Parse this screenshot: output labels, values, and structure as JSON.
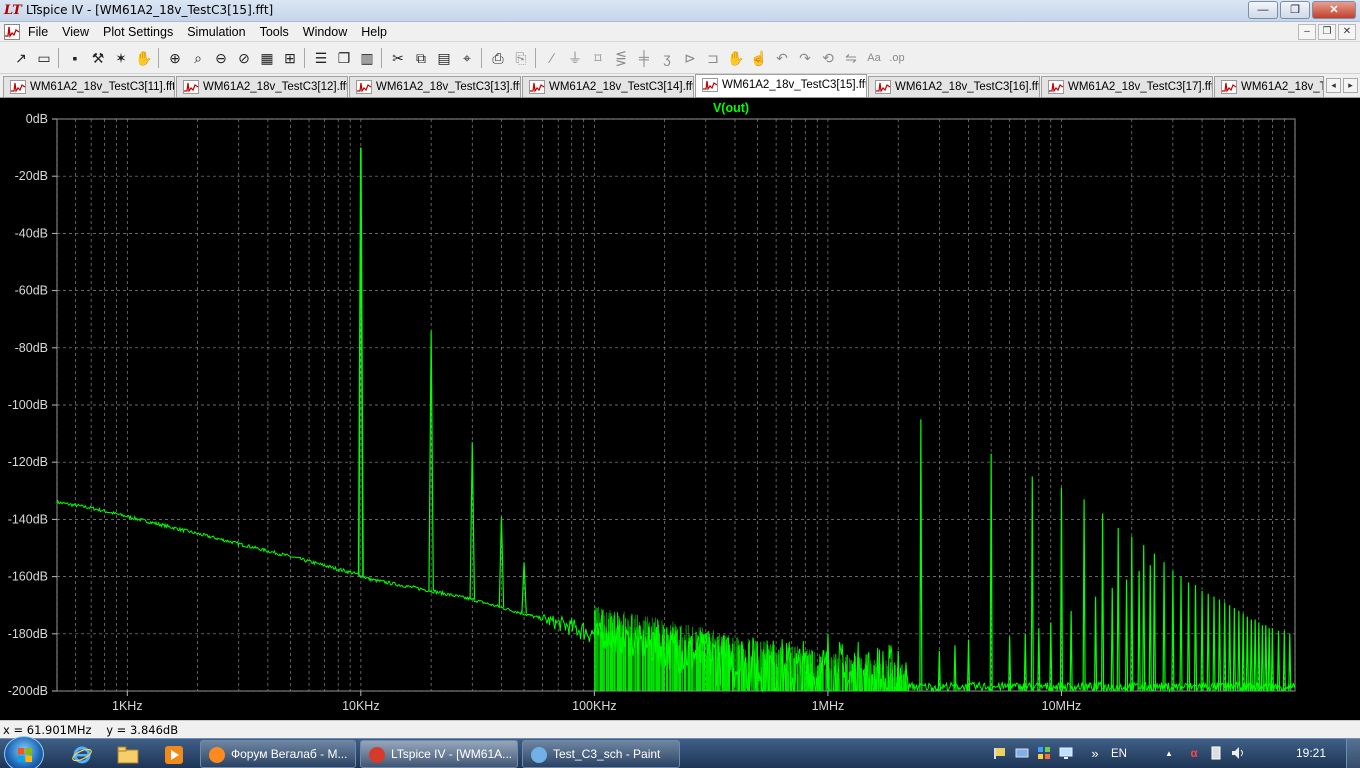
{
  "window": {
    "title": "LTspice IV - [WM61A2_18v_TestC3[15].fft]",
    "logo_text": "LT",
    "minimize_glyph": "—",
    "maximize_glyph": "❐",
    "close_glyph": "✕"
  },
  "menu": {
    "items": [
      "File",
      "View",
      "Plot Settings",
      "Simulation",
      "Tools",
      "Window",
      "Help"
    ],
    "mdi_minimize_glyph": "–",
    "mdi_restore_glyph": "❐",
    "mdi_close_glyph": "✕"
  },
  "toolbar": {
    "icons": [
      "new-schematic-icon",
      "open-icon",
      "save-icon",
      "control-panel-icon",
      "run-icon",
      "pan-icon",
      "zoom-in-icon",
      "zoom-pan-icon",
      "zoom-out-icon",
      "zoom-cancel-icon",
      "autorange-icon",
      "zoom-fit-icon",
      "tile-horizontal-icon",
      "cascade-icon",
      "tile-vertical-icon",
      "cut-icon",
      "copy-icon",
      "paste-icon",
      "find-icon",
      "print-icon",
      "print-preview-icon",
      "wire-icon",
      "ground-icon",
      "label-icon",
      "resistor-icon",
      "capacitor-icon",
      "inductor-icon",
      "diode-icon",
      "component-icon",
      "move-icon",
      "drag-icon",
      "undo-icon",
      "redo-icon",
      "rotate-icon",
      "mirror-icon",
      "text-icon",
      "spice-directive-icon"
    ]
  },
  "tabs": [
    {
      "label": "WM61A2_18v_TestC3[11].fft",
      "active": false
    },
    {
      "label": "WM61A2_18v_TestC3[12].fft",
      "active": false
    },
    {
      "label": "WM61A2_18v_TestC3[13].fft",
      "active": false
    },
    {
      "label": "WM61A2_18v_TestC3[14].fft",
      "active": false
    },
    {
      "label": "WM61A2_18v_TestC3[15].fft",
      "active": true
    },
    {
      "label": "WM61A2_18v_TestC3[16].fft",
      "active": false
    },
    {
      "label": "WM61A2_18v_TestC3[17].fft",
      "active": false
    },
    {
      "label": "WM61A2_18v_T",
      "active": false
    }
  ],
  "tab_scroll": {
    "left": "◂",
    "right": "▸"
  },
  "chart_data": {
    "type": "line",
    "trace_name": "V(out)",
    "trace_color": "#00ff00",
    "background": "#000000",
    "grid": true,
    "x_scale": "log",
    "x_unit": "Hz",
    "xlim": [
      500,
      100000000
    ],
    "ylim": [
      -200,
      0
    ],
    "x_ticks": [
      {
        "value": 1000,
        "label": "1KHz"
      },
      {
        "value": 10000,
        "label": "10KHz"
      },
      {
        "value": 100000,
        "label": "100KHz"
      },
      {
        "value": 1000000,
        "label": "1MHz"
      },
      {
        "value": 10000000,
        "label": "10MHz"
      }
    ],
    "y_ticks": [
      {
        "value": 0,
        "label": "0dB"
      },
      {
        "value": -20,
        "label": "-20dB"
      },
      {
        "value": -40,
        "label": "-40dB"
      },
      {
        "value": -60,
        "label": "-60dB"
      },
      {
        "value": -80,
        "label": "-80dB"
      },
      {
        "value": -100,
        "label": "-100dB"
      },
      {
        "value": -120,
        "label": "-120dB"
      },
      {
        "value": -140,
        "label": "-140dB"
      },
      {
        "value": -160,
        "label": "-160dB"
      },
      {
        "value": -180,
        "label": "-180dB"
      },
      {
        "value": -200,
        "label": "-200dB"
      }
    ],
    "noise_floor": [
      {
        "x": 500,
        "y": -134
      },
      {
        "x": 700,
        "y": -136
      },
      {
        "x": 1000,
        "y": -139
      },
      {
        "x": 2000,
        "y": -145
      },
      {
        "x": 5000,
        "y": -153
      },
      {
        "x": 9500,
        "y": -159
      },
      {
        "x": 11000,
        "y": -161
      },
      {
        "x": 20000,
        "y": -165
      },
      {
        "x": 30000,
        "y": -168
      },
      {
        "x": 50000,
        "y": -173
      },
      {
        "x": 100000,
        "y": -180
      },
      {
        "x": 200000,
        "y": -185
      },
      {
        "x": 500000,
        "y": -192
      },
      {
        "x": 1000000,
        "y": -196
      },
      {
        "x": 2000000,
        "y": -200
      }
    ],
    "peaks": [
      {
        "x": 10000,
        "y": -10
      },
      {
        "x": 20000,
        "y": -74
      },
      {
        "x": 30000,
        "y": -113
      },
      {
        "x": 40000,
        "y": -139
      },
      {
        "x": 50000,
        "y": -155
      },
      {
        "x": 1000000,
        "y": -180
      },
      {
        "x": 2000000,
        "y": -186
      },
      {
        "x": 2500000,
        "y": -105
      },
      {
        "x": 3000000,
        "y": -186
      },
      {
        "x": 3500000,
        "y": -184
      },
      {
        "x": 4000000,
        "y": -182
      },
      {
        "x": 5000000,
        "y": -117
      },
      {
        "x": 6000000,
        "y": -181
      },
      {
        "x": 7000000,
        "y": -180
      },
      {
        "x": 7500000,
        "y": -125
      },
      {
        "x": 8000000,
        "y": -178
      },
      {
        "x": 9000000,
        "y": -176
      },
      {
        "x": 10000000,
        "y": -129
      },
      {
        "x": 11000000,
        "y": -172
      },
      {
        "x": 12500000,
        "y": -133
      },
      {
        "x": 14000000,
        "y": -167
      },
      {
        "x": 15000000,
        "y": -138
      },
      {
        "x": 16500000,
        "y": -164
      },
      {
        "x": 17500000,
        "y": -143
      },
      {
        "x": 19000000,
        "y": -161
      },
      {
        "x": 20000000,
        "y": -146
      },
      {
        "x": 21500000,
        "y": -158
      },
      {
        "x": 22500000,
        "y": -149
      },
      {
        "x": 24000000,
        "y": -156
      },
      {
        "x": 25000000,
        "y": -152
      },
      {
        "x": 27500000,
        "y": -155
      },
      {
        "x": 30000000,
        "y": -158
      },
      {
        "x": 32500000,
        "y": -160
      },
      {
        "x": 35000000,
        "y": -162
      },
      {
        "x": 37500000,
        "y": -163
      },
      {
        "x": 40000000,
        "y": -165
      },
      {
        "x": 42500000,
        "y": -166
      },
      {
        "x": 45000000,
        "y": -167
      },
      {
        "x": 47500000,
        "y": -168
      },
      {
        "x": 50000000,
        "y": -169
      },
      {
        "x": 52500000,
        "y": -170
      },
      {
        "x": 55000000,
        "y": -171
      },
      {
        "x": 57500000,
        "y": -172
      },
      {
        "x": 60000000,
        "y": -173
      },
      {
        "x": 62500000,
        "y": -174
      },
      {
        "x": 65000000,
        "y": -175
      },
      {
        "x": 67500000,
        "y": -175
      },
      {
        "x": 70000000,
        "y": -176
      },
      {
        "x": 72500000,
        "y": -177
      },
      {
        "x": 75000000,
        "y": -177
      },
      {
        "x": 77500000,
        "y": -178
      },
      {
        "x": 80000000,
        "y": -178
      },
      {
        "x": 85000000,
        "y": -179
      },
      {
        "x": 90000000,
        "y": -179
      },
      {
        "x": 95000000,
        "y": -180
      }
    ]
  },
  "status": {
    "cursor_readout": "x = 61.901MHz    y = 3.846dB"
  },
  "taskbar": {
    "tasks": [
      {
        "label": "Форум Вегалаб - М...",
        "icon": "firefox-icon",
        "active": false
      },
      {
        "label": "LTspice IV - [WM61A...",
        "icon": "ltspice-icon",
        "active": true
      },
      {
        "label": "Test_C3_sch - Paint",
        "icon": "paint-icon",
        "active": false
      }
    ],
    "language": "EN",
    "clock": "19:21",
    "expand_glyph": "»",
    "tray_up_glyph": "▲"
  }
}
